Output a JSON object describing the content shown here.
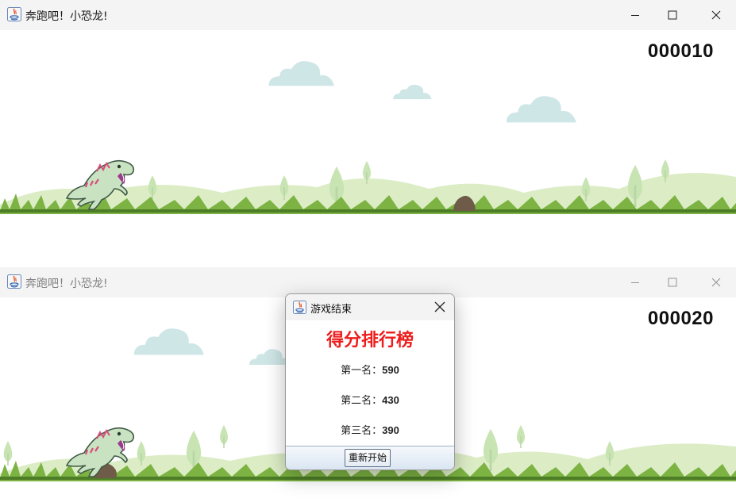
{
  "windows": [
    {
      "title": "奔跑吧！小恐龙!",
      "score": "000010",
      "state": "active"
    },
    {
      "title": "奔跑吧！小恐龙!",
      "score": "000020",
      "state": "inactive"
    }
  ],
  "dialog": {
    "title": "游戏结束",
    "heading": "得分排行榜",
    "ranks": [
      {
        "label": "第一名：",
        "score": "590"
      },
      {
        "label": "第二名：",
        "score": "430"
      },
      {
        "label": "第三名：",
        "score": "390"
      }
    ],
    "restart_label": "重新开始"
  },
  "icons": {
    "app": "java-app-icon",
    "minimize": "minimize-icon",
    "maximize": "maximize-icon",
    "close": "close-icon"
  },
  "colors": {
    "heading": "#ee1c1c",
    "grass": "#6aa338",
    "hills": "#d9ecc0",
    "clouds": "#cfe6e6",
    "dino": "#c9e2c2"
  }
}
